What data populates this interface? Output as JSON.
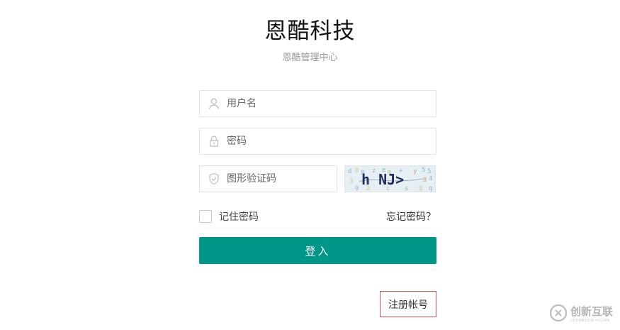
{
  "header": {
    "title": "恩酷科技",
    "subtitle": "恩酷管理中心"
  },
  "form": {
    "username_placeholder": "用户名",
    "password_placeholder": "密码",
    "captcha_placeholder": "图形验证码",
    "captcha_text": "h NJ>",
    "remember_label": "记住密码",
    "forgot_label": "忘记密码？",
    "login_label": "登入",
    "register_label": "注册帐号"
  },
  "colors": {
    "accent": "#009688",
    "register_border": "#d9534f"
  },
  "icons": {
    "username": "user-icon",
    "password": "lock-icon",
    "captcha": "shield-check-icon"
  },
  "watermark": {
    "text": "创新互联",
    "sub": "CHUANGXIN HULIAN"
  }
}
